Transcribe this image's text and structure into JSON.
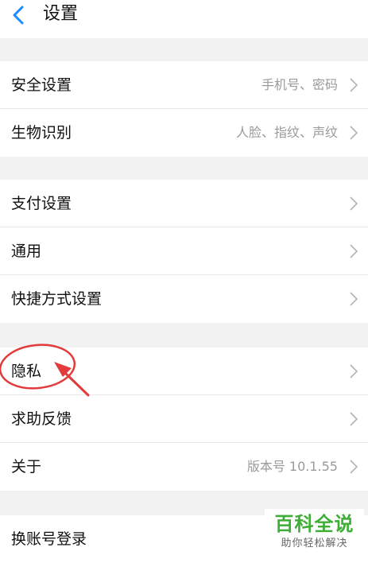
{
  "header": {
    "title": "设置",
    "back_icon": "chevron-left-icon"
  },
  "colors": {
    "accent": "#1a8cff",
    "annotation": "#e23b3b",
    "watermark": "#3fae36"
  },
  "groups": [
    {
      "items": [
        {
          "label": "安全设置",
          "value": "手机号、密码"
        },
        {
          "label": "生物识别",
          "value": "人脸、指纹、声纹"
        }
      ]
    },
    {
      "items": [
        {
          "label": "支付设置",
          "value": ""
        },
        {
          "label": "通用",
          "value": ""
        },
        {
          "label": "快捷方式设置",
          "value": ""
        }
      ]
    },
    {
      "items": [
        {
          "label": "隐私",
          "value": ""
        },
        {
          "label": "求助反馈",
          "value": ""
        },
        {
          "label": "关于",
          "value": "版本号 10.1.55"
        }
      ]
    },
    {
      "items": [
        {
          "label": "换账号登录",
          "value": ""
        }
      ]
    }
  ],
  "watermark": {
    "main": "百科全说",
    "sub": "助你轻松解决"
  }
}
